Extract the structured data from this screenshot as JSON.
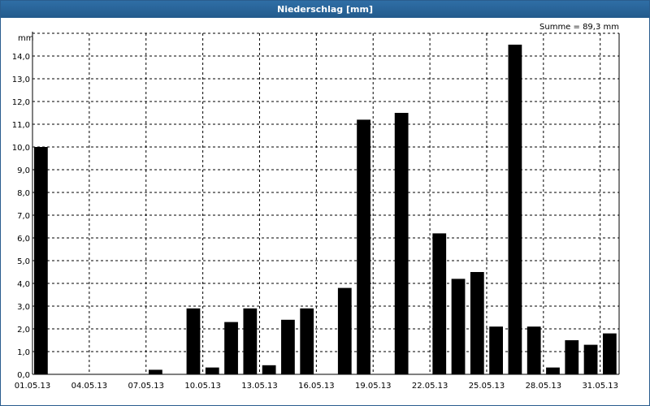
{
  "window": {
    "title": "Niederschlag [mm]"
  },
  "summary": "Summe = 89,3 mm",
  "chart_data": {
    "type": "bar",
    "title": "Niederschlag [mm]",
    "ylabel": "mm",
    "xlabel": "",
    "ylim": [
      0,
      15
    ],
    "grid": true,
    "categories": [
      "01.05.13",
      "02.05.13",
      "03.05.13",
      "04.05.13",
      "05.05.13",
      "06.05.13",
      "07.05.13",
      "08.05.13",
      "09.05.13",
      "10.05.13",
      "11.05.13",
      "12.05.13",
      "13.05.13",
      "14.05.13",
      "15.05.13",
      "16.05.13",
      "17.05.13",
      "18.05.13",
      "19.05.13",
      "20.05.13",
      "21.05.13",
      "22.05.13",
      "23.05.13",
      "24.05.13",
      "25.05.13",
      "26.05.13",
      "27.05.13",
      "28.05.13",
      "29.05.13",
      "30.05.13",
      "31.05.13"
    ],
    "values": [
      10.0,
      0,
      0,
      0,
      0,
      0,
      0.2,
      0,
      2.9,
      0.3,
      2.3,
      2.9,
      0.4,
      2.4,
      2.9,
      0,
      3.8,
      11.2,
      0,
      11.5,
      0,
      6.2,
      4.2,
      4.5,
      2.1,
      14.5,
      2.1,
      0.3,
      1.5,
      1.3,
      1.8
    ],
    "xtick_labels": [
      "01.05.13",
      "04.05.13",
      "07.05.13",
      "10.05.13",
      "13.05.13",
      "16.05.13",
      "19.05.13",
      "22.05.13",
      "25.05.13",
      "28.05.13",
      "31.05.13"
    ],
    "ytick_labels": [
      "0,0",
      "1,0",
      "2,0",
      "3,0",
      "4,0",
      "5,0",
      "6,0",
      "7,0",
      "8,0",
      "9,0",
      "10,0",
      "11,0",
      "12,0",
      "13,0",
      "14,0"
    ],
    "bar_color": "#000000",
    "grid_color": "#000000"
  }
}
